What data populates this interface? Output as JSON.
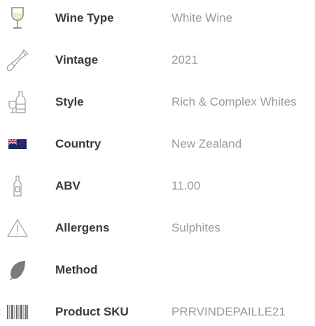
{
  "specs": [
    {
      "icon": "wine-glass-icon",
      "label": "Wine Type",
      "value": "White Wine"
    },
    {
      "icon": "wine-bottle-icon",
      "label": "Vintage",
      "value": "2021"
    },
    {
      "icon": "bottle-and-glass-icon",
      "label": "Style",
      "value": "Rich & Complex Whites"
    },
    {
      "icon": "new-zealand-flag-icon",
      "label": "Country",
      "value": "New Zealand"
    },
    {
      "icon": "small-bottle-icon",
      "label": "ABV",
      "value": "11.00"
    },
    {
      "icon": "warning-triangle-icon",
      "label": "Allergens",
      "value": "Sulphites"
    },
    {
      "icon": "leaf-icon",
      "label": "Method",
      "value": ""
    },
    {
      "icon": "barcode-icon",
      "label": "Product SKU",
      "value": "PRRVINDEPAILLE21"
    }
  ]
}
